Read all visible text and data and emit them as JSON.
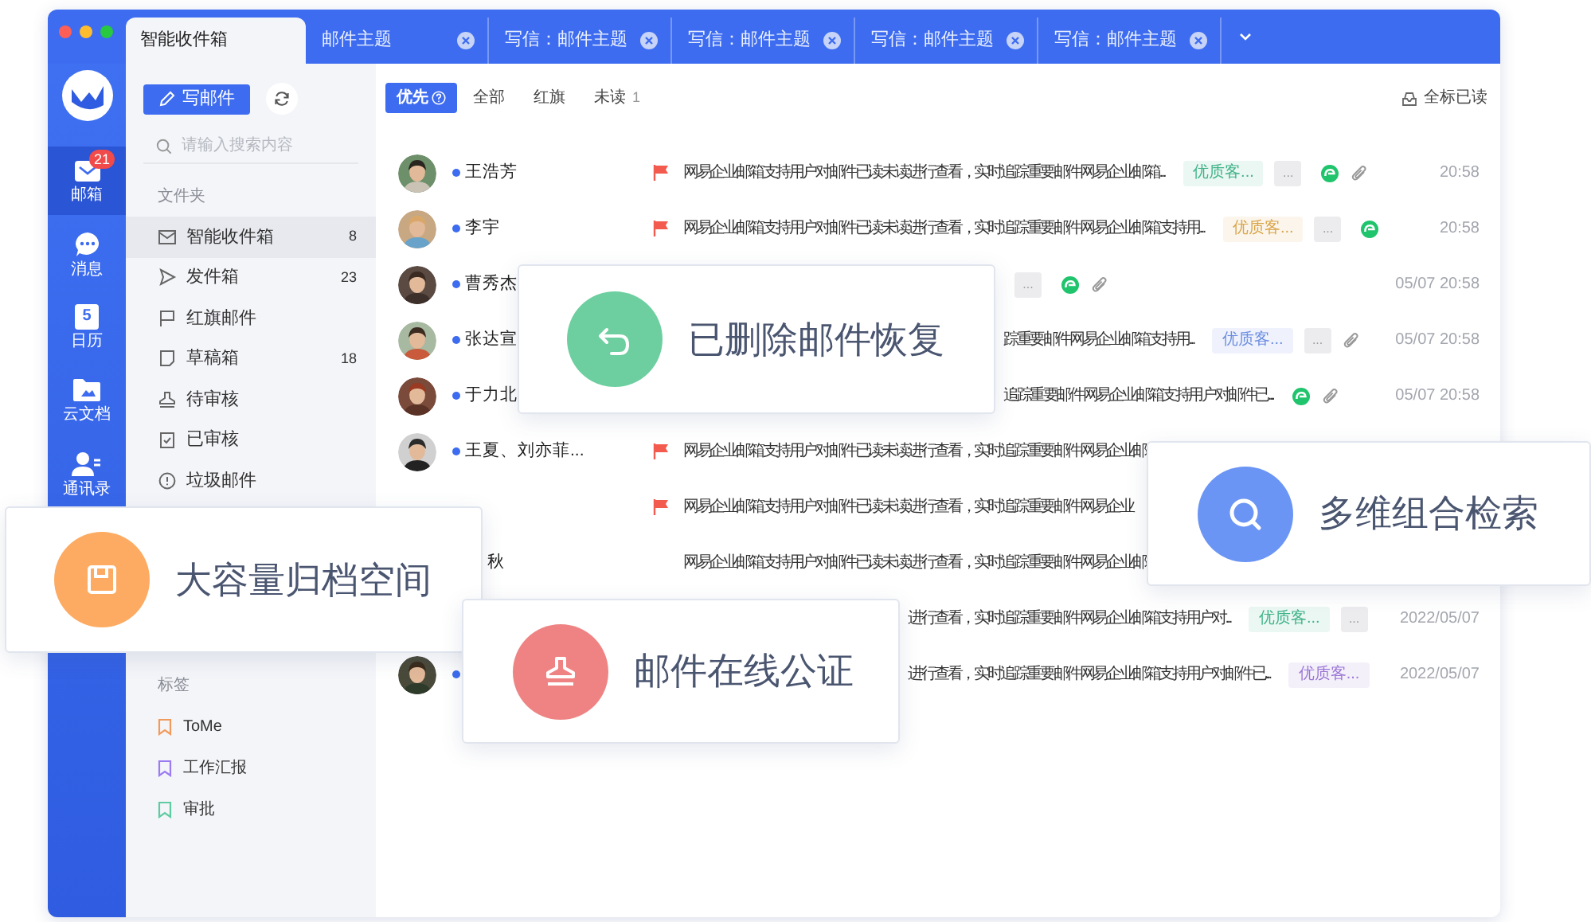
{
  "tabs": [
    {
      "label": "智能收件箱",
      "selected": true,
      "closable": false
    },
    {
      "label": "邮件主题",
      "selected": false,
      "closable": true
    },
    {
      "label": "写信：邮件主题",
      "selected": false,
      "closable": true
    },
    {
      "label": "写信：邮件主题",
      "selected": false,
      "closable": true
    },
    {
      "label": "写信：邮件主题",
      "selected": false,
      "closable": true
    },
    {
      "label": "写信：邮件主题",
      "selected": false,
      "closable": true
    }
  ],
  "rail": [
    {
      "kind": "mail",
      "label": "邮箱",
      "selected": true,
      "badge": "21"
    },
    {
      "kind": "chat",
      "label": "消息",
      "selected": false
    },
    {
      "kind": "calendar",
      "label": "日历",
      "day": "5",
      "selected": false
    },
    {
      "kind": "docs",
      "label": "云文档",
      "selected": false
    },
    {
      "kind": "contacts",
      "label": "通讯录",
      "selected": false
    }
  ],
  "compose_button": "写邮件",
  "search": {
    "placeholder": "请输入搜索内容"
  },
  "folders_heading": "文件夹",
  "folders": [
    {
      "kind": "inbox",
      "label": "智能收件箱",
      "count": "8",
      "selected": true
    },
    {
      "kind": "sent",
      "label": "发件箱",
      "count": "23",
      "selected": false
    },
    {
      "kind": "flag",
      "label": "红旗邮件",
      "selected": false
    },
    {
      "kind": "draft",
      "label": "草稿箱",
      "count": "18",
      "selected": false
    },
    {
      "kind": "stamp",
      "label": "待审核",
      "selected": false
    },
    {
      "kind": "checked",
      "label": "已审核",
      "selected": false
    },
    {
      "kind": "spam",
      "label": "垃圾邮件",
      "selected": false
    }
  ],
  "tags_heading": "标签",
  "tags": [
    {
      "label": "ToMe",
      "color": "#f29a5c"
    },
    {
      "label": "工作汇报",
      "color": "#9b7cf0"
    },
    {
      "label": "审批",
      "color": "#5fcba0"
    }
  ],
  "filters": [
    {
      "label": "优先",
      "selected": true,
      "help": true
    },
    {
      "label": "全部",
      "selected": false,
      "help": false
    },
    {
      "label": "红旗",
      "selected": false,
      "help": false
    },
    {
      "label": "未读",
      "count": "1",
      "selected": false,
      "help": false
    }
  ],
  "mark_all_read": "全标已读",
  "mails": [
    {
      "kind": "full",
      "avatar": true,
      "unread": true,
      "name": "王浩芳",
      "flagged": true,
      "snippet": "网易企业邮箱支持用户对邮件已读未读进行查看，实时追踪重要邮件网易企业邮箱...",
      "tag": {
        "text": "优质客...",
        "color": "#3fb389"
      },
      "more": "...",
      "chat": true,
      "attachment": true,
      "time": "20:58"
    },
    {
      "kind": "full",
      "avatar": true,
      "unread": true,
      "name": "李宇",
      "flagged": true,
      "snippet": "网易企业邮箱支持用户对邮件已读未读进行查看，实时追踪重要邮件网易企业邮箱支持用...",
      "tag": {
        "text": "优质客...",
        "color": "#d9a54a"
      },
      "more": "...",
      "chat": true,
      "attachment": false,
      "time": "20:58"
    },
    {
      "kind": "tail",
      "avatar": true,
      "unread": true,
      "name": "曹秀杰",
      "flagged": false,
      "more": "...",
      "chat": true,
      "attachment": true,
      "time": "05/07 20:58"
    },
    {
      "kind": "tail",
      "avatar": true,
      "unread": true,
      "name": "张达宣",
      "flagged": false,
      "snippet": "踪重要邮件网易企业邮箱支持用...",
      "tag": {
        "text": "优质客...",
        "color": "#6b8de0"
      },
      "more": "...",
      "chat": false,
      "attachment": true,
      "time": "05/07 20:58"
    },
    {
      "kind": "tail",
      "avatar": true,
      "unread": true,
      "name": "于力北",
      "flagged": false,
      "snippet": "追踪重要邮件网易企业邮箱支持用户对邮件已...",
      "chat": true,
      "attachment": true,
      "time": "05/07 20:58"
    },
    {
      "kind": "full",
      "avatar": true,
      "unread": true,
      "name": "王夏、刘亦菲...",
      "flagged": true,
      "snippet": "网易企业邮箱支持用户对邮件已读未读进行查看，实时追踪重要邮件网易企业邮",
      "chat": false,
      "attachment": false
    },
    {
      "kind": "full",
      "avatar": false,
      "unread": false,
      "flagged": true,
      "snippet": "网易企业邮箱支持用户对邮件已读未读进行查看，实时追踪重要邮件网易企业",
      "chat": false,
      "attachment": false
    },
    {
      "kind": "full",
      "avatar": false,
      "unread": false,
      "name": "秋",
      "flagged": false,
      "snippet": "网易企业邮箱支持用户对邮件已读未读进行查看，实时追踪重要邮件网易企业邮",
      "chat": false,
      "attachment": false
    },
    {
      "kind": "tail",
      "avatar": false,
      "unread": false,
      "flagged": false,
      "snippet": "进行查看，实时追踪重要邮件网易企业邮箱支持用户对...",
      "tag": {
        "text": "优质客...",
        "color": "#3fb389"
      },
      "more": "...",
      "chat": false,
      "attachment": false,
      "time": "2022/05/07"
    },
    {
      "kind": "tail",
      "avatar": true,
      "unread": true,
      "flagged": false,
      "snippet": "进行查看，实时追踪重要邮件网易企业邮箱支持用户对邮件已...",
      "tag": {
        "text": "优质客...",
        "color": "#9a76d6"
      },
      "chat": false,
      "attachment": false,
      "time": "2022/05/07"
    }
  ],
  "features": [
    {
      "kind": "restore",
      "label": "已删除邮件恢复"
    },
    {
      "kind": "search",
      "label": "多维组合检索"
    },
    {
      "kind": "archive",
      "label": "大容量归档空间"
    },
    {
      "kind": "notary",
      "label": "邮件在线公证"
    }
  ]
}
